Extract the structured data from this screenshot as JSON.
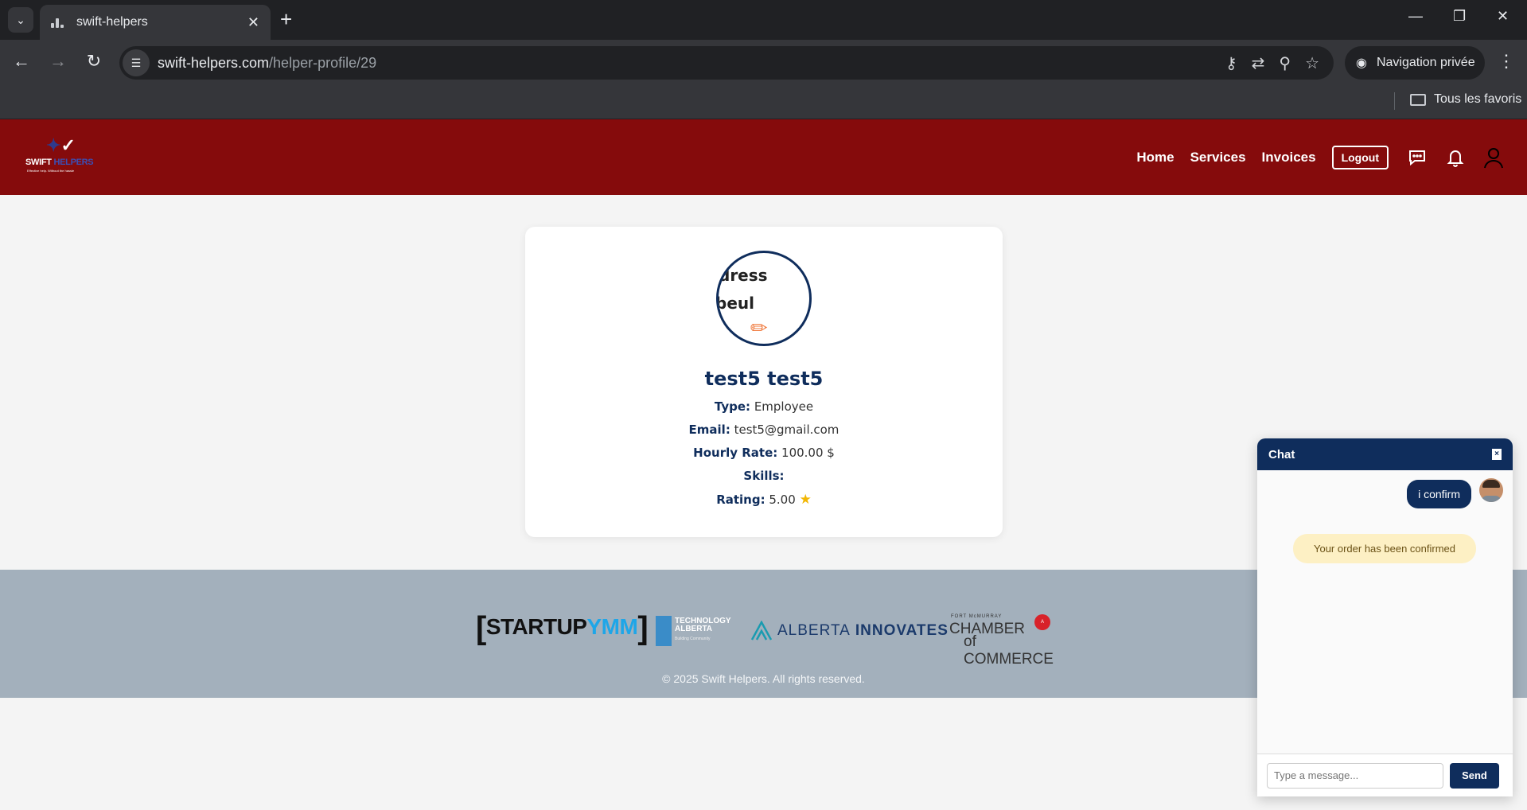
{
  "browser": {
    "tab_title": "swift-helpers",
    "url_host": "swift-helpers.com",
    "url_path": "/helper-profile/29",
    "incognito_label": "Navigation privée",
    "bookmarks_label": "Tous les favoris"
  },
  "site": {
    "logo_text": "SWIFT",
    "logo_text_accent": "HELPERS",
    "logo_tagline": "Effective help. Without the hassle",
    "nav": {
      "home": "Home",
      "services": "Services",
      "invoices": "Invoices",
      "logout": "Logout"
    }
  },
  "profile": {
    "avatar_text_1": "dress",
    "avatar_text_2": "beul",
    "name": "test5 test5",
    "type_label": "Type:",
    "type_value": "Employee",
    "email_label": "Email:",
    "email_value": "test5@gmail.com",
    "rate_label": "Hourly Rate:",
    "rate_value": "100.00 $",
    "skills_label": "Skills:",
    "skills_value": "",
    "rating_label": "Rating:",
    "rating_value": "5.00"
  },
  "footer": {
    "sponsors": {
      "startup": "STARTUP",
      "startup_accent": "YMM",
      "tech_line1": "TECHNOLOGY",
      "tech_line2": "ALBERTA",
      "tech_sub": "Building Community",
      "ai_left": "ALBERTA",
      "ai_right": "INNOVATES",
      "chamber_small": "FORT McMURRAY",
      "chamber_1": "CHAMBER",
      "chamber_2": "of COMMERCE",
      "chamber_badge": "A"
    },
    "copyright": "© 2025 Swift Helpers. All rights reserved."
  },
  "chat": {
    "title": "Chat",
    "close_label": "×",
    "messages": [
      {
        "from": "me",
        "text": "i confirm"
      },
      {
        "from": "system",
        "text": "Your order has been confirmed"
      }
    ],
    "input_placeholder": "Type a message...",
    "send_label": "Send"
  }
}
